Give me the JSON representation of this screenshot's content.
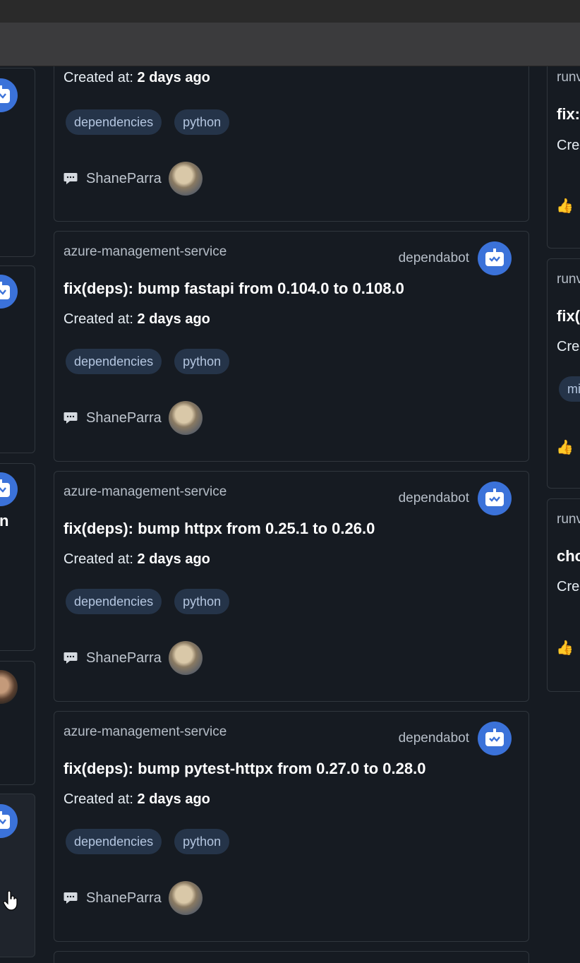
{
  "middle_cards": [
    {
      "repo": "",
      "author": "",
      "title": "",
      "created_prefix": "Created at:",
      "created_value": "2 days ago",
      "labels": [
        "dependencies",
        "python"
      ],
      "reviewer": "ShaneParra"
    },
    {
      "repo": "azure-management-service",
      "author": "dependabot",
      "title": "fix(deps): bump fastapi from 0.104.0 to 0.108.0",
      "created_prefix": "Created at:",
      "created_value": "2 days ago",
      "labels": [
        "dependencies",
        "python"
      ],
      "reviewer": "ShaneParra"
    },
    {
      "repo": "azure-management-service",
      "author": "dependabot",
      "title": "fix(deps): bump httpx from 0.25.1 to 0.26.0",
      "created_prefix": "Created at:",
      "created_value": "2 days ago",
      "labels": [
        "dependencies",
        "python"
      ],
      "reviewer": "ShaneParra"
    },
    {
      "repo": "azure-management-service",
      "author": "dependabot",
      "title": "fix(deps): bump pytest-httpx from 0.27.0 to 0.28.0",
      "created_prefix": "Created at:",
      "created_value": "2 days ago",
      "labels": [
        "dependencies",
        "python"
      ],
      "reviewer": "ShaneParra"
    }
  ],
  "left_cards": [
    {
      "text": ""
    },
    {
      "text": ""
    },
    {
      "text": "n"
    },
    {
      "text": ""
    },
    {
      "text": ""
    }
  ],
  "right_cards": [
    {
      "repo": "runv",
      "title": "fix:",
      "created": "Cre",
      "label": "",
      "thumb": "👍"
    },
    {
      "repo": "runv",
      "title": "fix(",
      "created": "Cre",
      "label": "mi",
      "thumb": "👍"
    },
    {
      "repo": "runv",
      "title": "cho",
      "created": "Cre",
      "label": "",
      "thumb": "👍"
    }
  ],
  "icons": {
    "bot": "robot-icon",
    "comment": "speech-bubble-icon",
    "thumb": "thumbs-up-icon",
    "cursor": "hand-pointer-icon"
  },
  "colors": {
    "background": "#161b22",
    "card_border": "#30363d",
    "label_bg": "#253449",
    "bot_avatar": "#3b72d9"
  }
}
